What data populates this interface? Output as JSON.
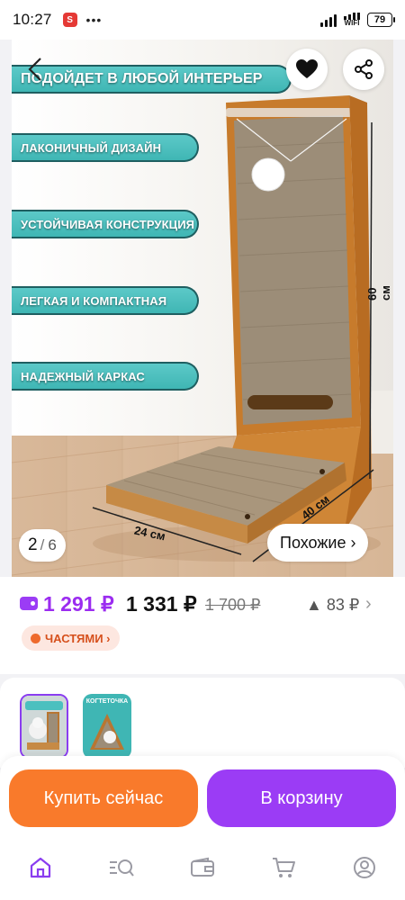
{
  "status_bar": {
    "time": "10:27",
    "wifi_label": "WIFI",
    "battery": "79"
  },
  "product_image": {
    "banners": [
      "ПОДОЙДЕТ В ЛЮБОЙ ИНТЕРЬЕР",
      "ЛАКОНИЧНЫЙ ДИЗАЙН",
      "УСТОЙЧИВАЯ КОНСТРУКЦИЯ",
      "ЛЕГКАЯ И КОМПАКТНАЯ",
      "НАДЕЖНЫЙ КАРКАС"
    ],
    "dimensions": {
      "height": "60 см",
      "depth": "40 см",
      "width": "24 см"
    },
    "pager": {
      "current": "2",
      "separator": "/",
      "total": "6"
    },
    "similar_label": "Похожие ›",
    "colors": {
      "banner": "#4cc0bf",
      "board": "#c47a2a",
      "cardboard": "#9c8d78"
    }
  },
  "price": {
    "wallet_price": "1 291 ₽",
    "main_price": "1 331 ₽",
    "old_price": "1 700 ₽",
    "drop": "▲ 83 ₽",
    "chevron": "›",
    "installments_label": "ЧАСТЯМИ ›",
    "accent_color": "#9b2cf0",
    "installments_color": "#d6501c"
  },
  "variants": {
    "thumb2_caption": "КОГТЕТОЧКА"
  },
  "actions": {
    "buy_now": "Купить сейчас",
    "add_to_cart": "В корзину",
    "buy_color": "#f97a2b",
    "cart_color": "#9b3cf5"
  },
  "bottom_nav": {
    "icons": [
      "home-icon",
      "catalog-search-icon",
      "wallet-icon",
      "cart-icon",
      "profile-icon"
    ]
  }
}
